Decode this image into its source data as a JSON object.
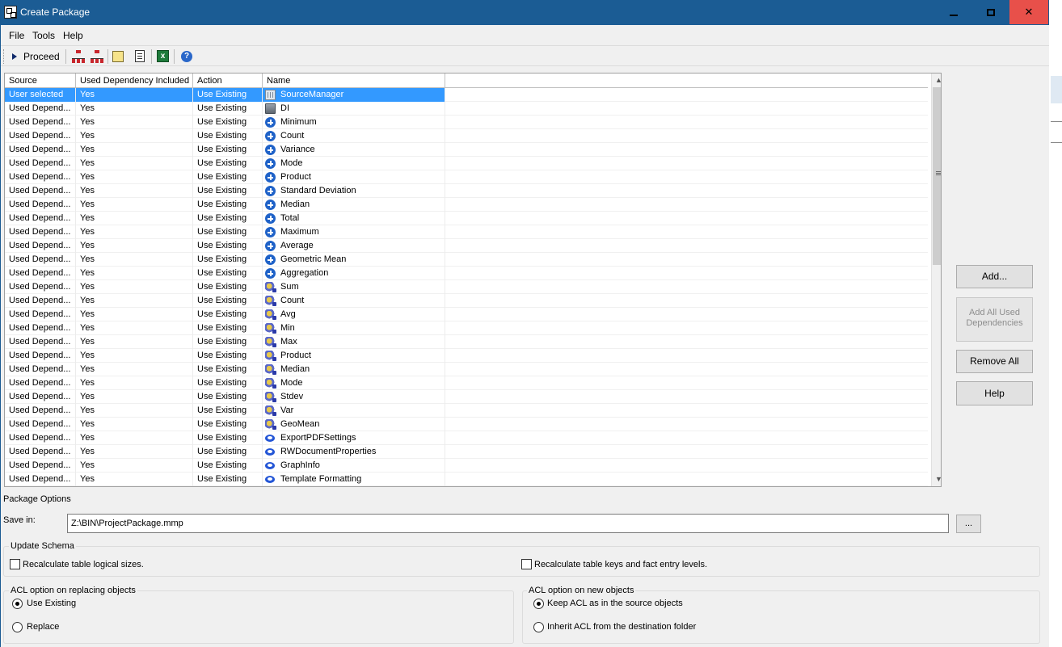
{
  "window": {
    "title": "Create Package"
  },
  "menu": {
    "items": [
      "File",
      "Tools",
      "Help"
    ]
  },
  "toolbar": {
    "proceed_label": "Proceed"
  },
  "grid": {
    "columns": [
      "Source",
      "Used Dependency Included",
      "Action",
      "Name"
    ],
    "rows": [
      {
        "source": "User selected",
        "included": "Yes",
        "action": "Use Existing",
        "name": "SourceManager",
        "icon": "grid"
      },
      {
        "source": "Used Depend...",
        "included": "Yes",
        "action": "Use Existing",
        "name": "DI",
        "icon": "box"
      },
      {
        "source": "Used Depend...",
        "included": "Yes",
        "action": "Use Existing",
        "name": "Minimum",
        "icon": "plus"
      },
      {
        "source": "Used Depend...",
        "included": "Yes",
        "action": "Use Existing",
        "name": "Count",
        "icon": "plus"
      },
      {
        "source": "Used Depend...",
        "included": "Yes",
        "action": "Use Existing",
        "name": "Variance",
        "icon": "plus"
      },
      {
        "source": "Used Depend...",
        "included": "Yes",
        "action": "Use Existing",
        "name": "Mode",
        "icon": "plus"
      },
      {
        "source": "Used Depend...",
        "included": "Yes",
        "action": "Use Existing",
        "name": "Product",
        "icon": "plus"
      },
      {
        "source": "Used Depend...",
        "included": "Yes",
        "action": "Use Existing",
        "name": "Standard Deviation",
        "icon": "plus"
      },
      {
        "source": "Used Depend...",
        "included": "Yes",
        "action": "Use Existing",
        "name": "Median",
        "icon": "plus"
      },
      {
        "source": "Used Depend...",
        "included": "Yes",
        "action": "Use Existing",
        "name": "Total",
        "icon": "plus"
      },
      {
        "source": "Used Depend...",
        "included": "Yes",
        "action": "Use Existing",
        "name": "Maximum",
        "icon": "plus"
      },
      {
        "source": "Used Depend...",
        "included": "Yes",
        "action": "Use Existing",
        "name": "Average",
        "icon": "plus"
      },
      {
        "source": "Used Depend...",
        "included": "Yes",
        "action": "Use Existing",
        "name": "Geometric Mean",
        "icon": "plus"
      },
      {
        "source": "Used Depend...",
        "included": "Yes",
        "action": "Use Existing",
        "name": "Aggregation",
        "icon": "plus"
      },
      {
        "source": "Used Depend...",
        "included": "Yes",
        "action": "Use Existing",
        "name": "Sum",
        "icon": "gear"
      },
      {
        "source": "Used Depend...",
        "included": "Yes",
        "action": "Use Existing",
        "name": "Count",
        "icon": "gear"
      },
      {
        "source": "Used Depend...",
        "included": "Yes",
        "action": "Use Existing",
        "name": "Avg",
        "icon": "gear"
      },
      {
        "source": "Used Depend...",
        "included": "Yes",
        "action": "Use Existing",
        "name": "Min",
        "icon": "gear"
      },
      {
        "source": "Used Depend...",
        "included": "Yes",
        "action": "Use Existing",
        "name": "Max",
        "icon": "gear"
      },
      {
        "source": "Used Depend...",
        "included": "Yes",
        "action": "Use Existing",
        "name": "Product",
        "icon": "gear"
      },
      {
        "source": "Used Depend...",
        "included": "Yes",
        "action": "Use Existing",
        "name": "Median",
        "icon": "gear"
      },
      {
        "source": "Used Depend...",
        "included": "Yes",
        "action": "Use Existing",
        "name": "Mode",
        "icon": "gear"
      },
      {
        "source": "Used Depend...",
        "included": "Yes",
        "action": "Use Existing",
        "name": "Stdev",
        "icon": "gear"
      },
      {
        "source": "Used Depend...",
        "included": "Yes",
        "action": "Use Existing",
        "name": "Var",
        "icon": "gear"
      },
      {
        "source": "Used Depend...",
        "included": "Yes",
        "action": "Use Existing",
        "name": "GeoMean",
        "icon": "gear"
      },
      {
        "source": "Used Depend...",
        "included": "Yes",
        "action": "Use Existing",
        "name": "ExportPDFSettings",
        "icon": "eye"
      },
      {
        "source": "Used Depend...",
        "included": "Yes",
        "action": "Use Existing",
        "name": "RWDocumentProperties",
        "icon": "eye"
      },
      {
        "source": "Used Depend...",
        "included": "Yes",
        "action": "Use Existing",
        "name": "GraphInfo",
        "icon": "eye"
      },
      {
        "source": "Used Depend...",
        "included": "Yes",
        "action": "Use Existing",
        "name": "Template Formatting",
        "icon": "eye"
      }
    ]
  },
  "side_buttons": {
    "add": "Add...",
    "add_all_line1": "Add All Used",
    "add_all_line2": "Dependencies",
    "remove_all": "Remove All",
    "help": "Help"
  },
  "package_options": {
    "heading": "Package Options",
    "save_in_label": "Save in:",
    "save_in_value": "Z:\\BIN\\ProjectPackage.mmp",
    "browse_label": "..."
  },
  "update_schema": {
    "title": "Update Schema",
    "recalc_logical": "Recalculate table logical sizes.",
    "recalc_keys": "Recalculate table keys and fact entry levels."
  },
  "acl_replacing": {
    "title": "ACL option on replacing objects",
    "use_existing": "Use Existing",
    "replace": "Replace"
  },
  "acl_new": {
    "title": "ACL option on new objects",
    "keep_acl": "Keep ACL as in the source objects",
    "inherit_acl": "Inherit ACL from the destination folder"
  }
}
